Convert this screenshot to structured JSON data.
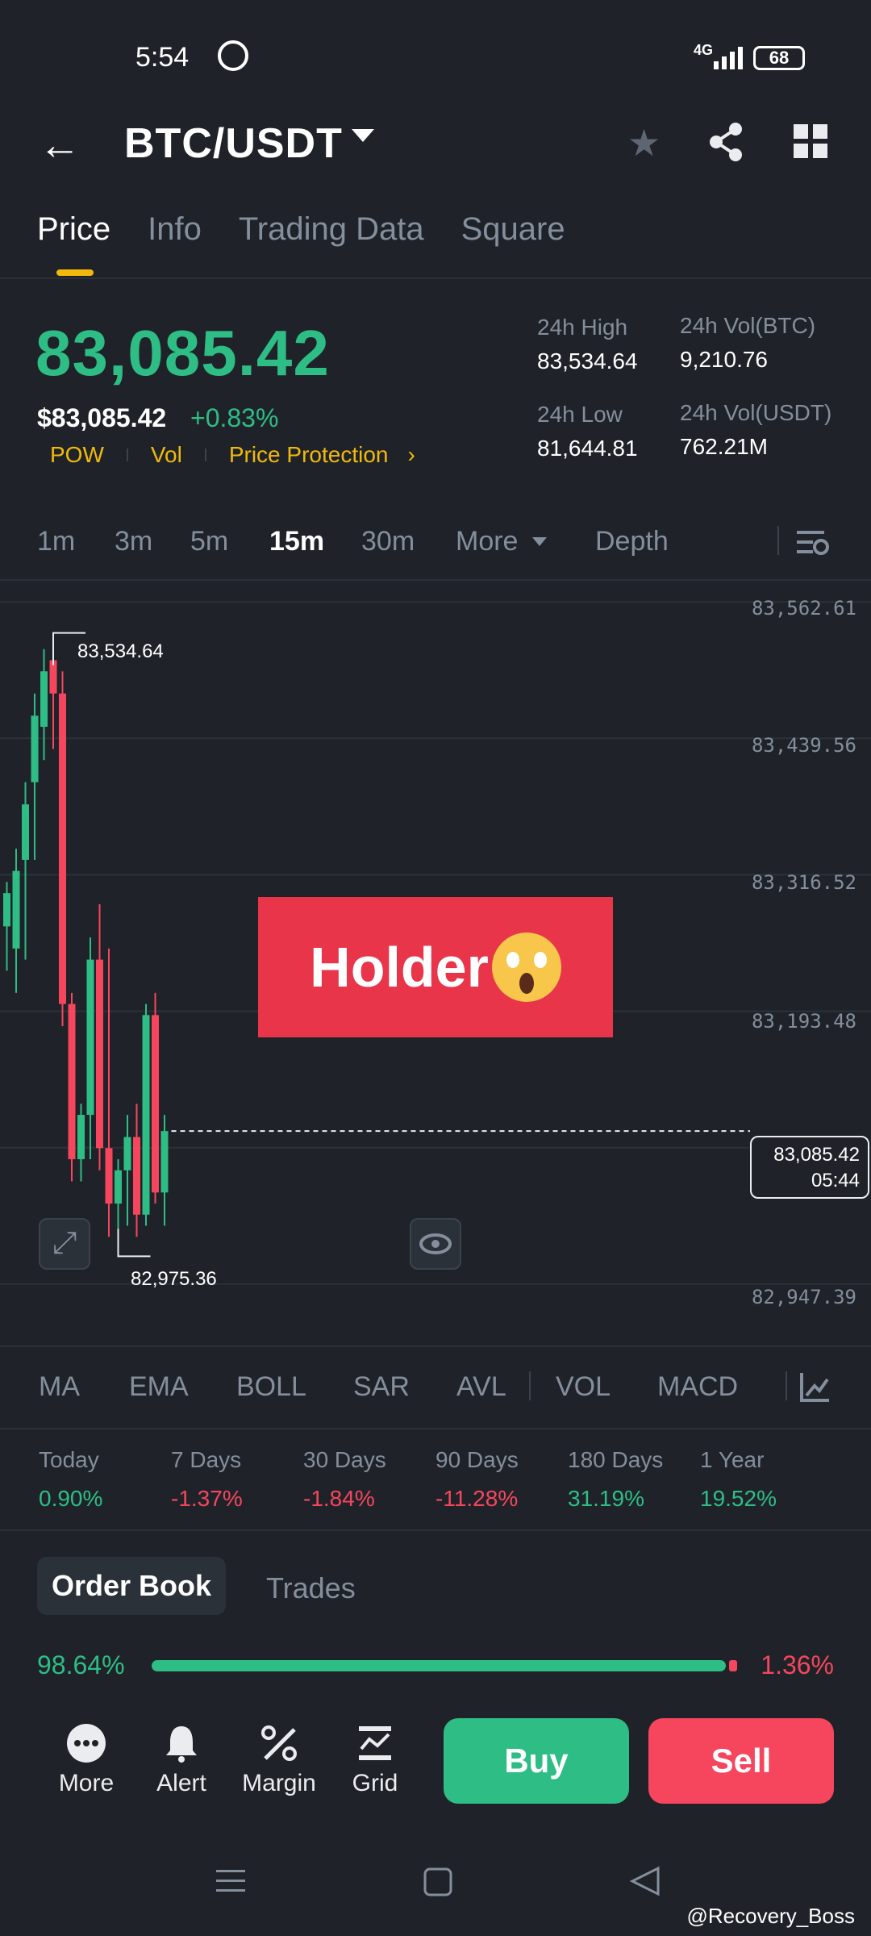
{
  "status": {
    "time": "5:54",
    "network": "4G",
    "battery": "68"
  },
  "header": {
    "pair": "BTC/USDT"
  },
  "tabs": [
    {
      "label": "Price"
    },
    {
      "label": "Info"
    },
    {
      "label": "Trading Data"
    },
    {
      "label": "Square"
    }
  ],
  "ticker": {
    "last_price": "83,085.42",
    "usd_price": "$83,085.42",
    "change": "+0.83%",
    "tags": [
      "POW",
      "Vol",
      "Price Protection"
    ],
    "high_label": "24h High",
    "high": "83,534.64",
    "low_label": "24h Low",
    "low": "81,644.81",
    "vol_btc_label": "24h Vol(BTC)",
    "vol_btc": "9,210.76",
    "vol_usdt_label": "24h Vol(USDT)",
    "vol_usdt": "762.21M"
  },
  "timeframes": {
    "items": [
      "1m",
      "3m",
      "5m",
      "15m",
      "30m",
      "More",
      "Depth"
    ],
    "selected": "15m"
  },
  "chart": {
    "y_ticks": [
      "83,562.61",
      "83,439.56",
      "83,316.52",
      "83,193.48",
      "82,947.39"
    ],
    "high_marker": "83,534.64",
    "low_marker": "82,975.36",
    "current_price": "83,085.42",
    "countdown": "05:44",
    "overlay_text": "Holder"
  },
  "chart_data": {
    "type": "candlestick",
    "y_range": [
      82940,
      83570
    ],
    "candles": [
      {
        "o": 83270,
        "h": 83310,
        "l": 83230,
        "c": 83300
      },
      {
        "o": 83250,
        "h": 83340,
        "l": 83210,
        "c": 83320
      },
      {
        "o": 83330,
        "h": 83400,
        "l": 83240,
        "c": 83380
      },
      {
        "o": 83400,
        "h": 83480,
        "l": 83330,
        "c": 83460
      },
      {
        "o": 83450,
        "h": 83520,
        "l": 83420,
        "c": 83500
      },
      {
        "o": 83510,
        "h": 83534.64,
        "l": 83430,
        "c": 83480
      },
      {
        "o": 83480,
        "h": 83500,
        "l": 83180,
        "c": 83200
      },
      {
        "o": 83200,
        "h": 83210,
        "l": 83040,
        "c": 83060
      },
      {
        "o": 83060,
        "h": 83110,
        "l": 83040,
        "c": 83100
      },
      {
        "o": 83100,
        "h": 83260,
        "l": 83060,
        "c": 83240
      },
      {
        "o": 83240,
        "h": 83290,
        "l": 83050,
        "c": 83070
      },
      {
        "o": 83070,
        "h": 83250,
        "l": 82990,
        "c": 83020
      },
      {
        "o": 83020,
        "h": 83060,
        "l": 82975.36,
        "c": 83050
      },
      {
        "o": 83050,
        "h": 83100,
        "l": 83000,
        "c": 83080
      },
      {
        "o": 83080,
        "h": 83110,
        "l": 82990,
        "c": 83010
      },
      {
        "o": 83010,
        "h": 83200,
        "l": 83000,
        "c": 83190
      },
      {
        "o": 83190,
        "h": 83210,
        "l": 83020,
        "c": 83030
      },
      {
        "o": 83030,
        "h": 83100,
        "l": 83000,
        "c": 83085.42
      }
    ]
  },
  "indicators": [
    "MA",
    "EMA",
    "BOLL",
    "SAR",
    "AVL",
    "VOL",
    "MACD"
  ],
  "performance": [
    {
      "label": "Today",
      "value": "0.90%",
      "up": true
    },
    {
      "label": "7 Days",
      "value": "-1.37%",
      "up": false
    },
    {
      "label": "30 Days",
      "value": "-1.84%",
      "up": false
    },
    {
      "label": "90 Days",
      "value": "-11.28%",
      "up": false
    },
    {
      "label": "180 Days",
      "value": "31.19%",
      "up": true
    },
    {
      "label": "1 Year",
      "value": "19.52%",
      "up": true
    }
  ],
  "orderbook": {
    "tab_active": "Order Book",
    "tab_other": "Trades",
    "buy_pct": "98.64%",
    "sell_pct": "1.36%",
    "buy_ratio": 0.9864
  },
  "bottom_nav": {
    "more": "More",
    "alert": "Alert",
    "margin": "Margin",
    "grid": "Grid",
    "buy": "Buy",
    "sell": "Sell"
  },
  "watermark": "@Recovery_Boss",
  "colors": {
    "green": "#2ebd85",
    "red": "#f6465d",
    "yellow": "#f0b90b",
    "bg": "#1f2329"
  }
}
